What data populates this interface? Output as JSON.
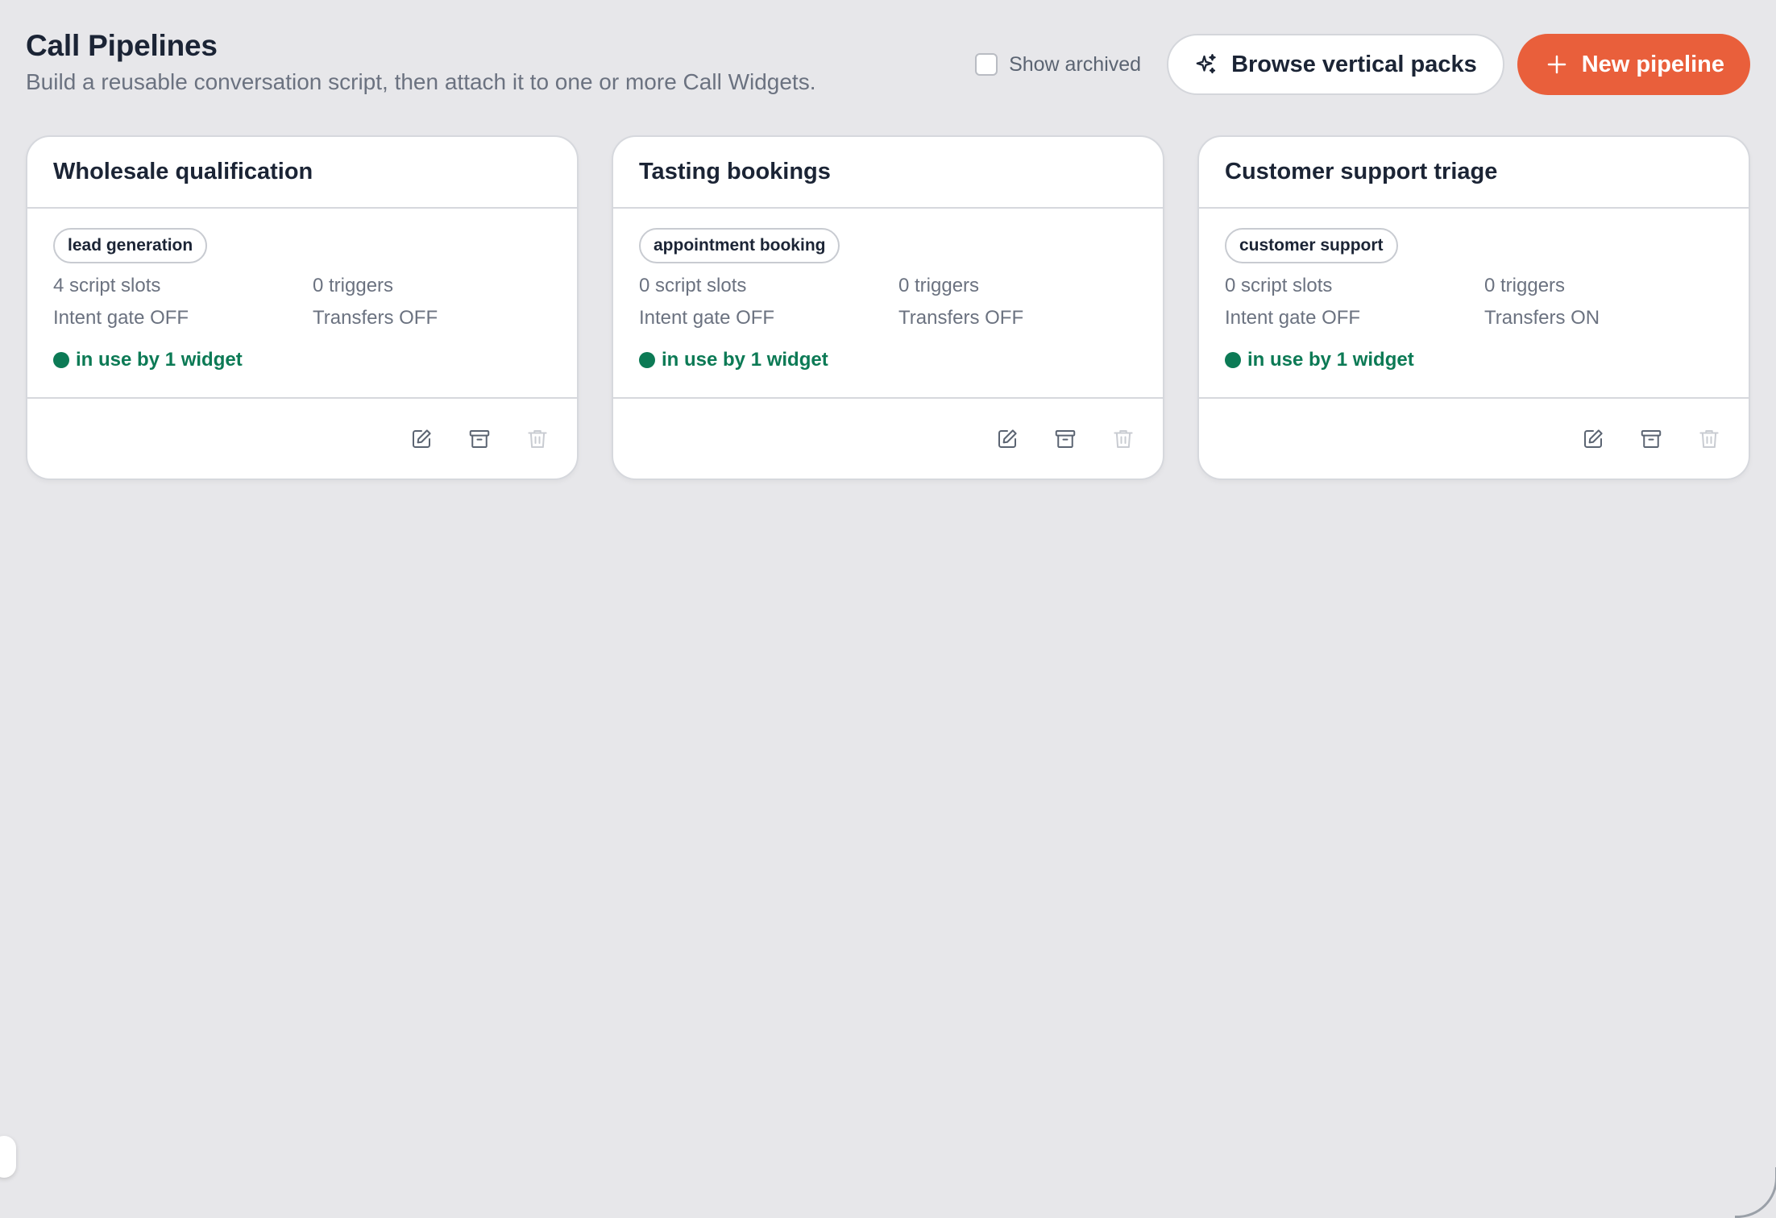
{
  "header": {
    "title": "Call Pipelines",
    "subtitle": "Build a reusable conversation script, then attach it to one or more Call Widgets."
  },
  "toolbar": {
    "show_archived_label": "Show archived",
    "show_archived_checked": false,
    "browse_label": "Browse vertical packs",
    "browse_icon": "sparkles-icon",
    "new_label": "New pipeline",
    "new_icon": "plus-icon"
  },
  "colors": {
    "background": "#e7e7ea",
    "accent": "#e95f3b",
    "status_green": "#0c7a55",
    "text": "#1b2435",
    "muted": "#6b7280"
  },
  "pipelines": [
    {
      "title": "Wholesale qualification",
      "tag": "lead generation",
      "script_slots": "4 script slots",
      "triggers": "0 triggers",
      "intent_gate": "Intent gate OFF",
      "transfers": "Transfers OFF",
      "usage": "in use by 1 widget"
    },
    {
      "title": "Tasting bookings",
      "tag": "appointment booking",
      "script_slots": "0 script slots",
      "triggers": "0 triggers",
      "intent_gate": "Intent gate OFF",
      "transfers": "Transfers OFF",
      "usage": "in use by 1 widget"
    },
    {
      "title": "Customer support triage",
      "tag": "customer support",
      "script_slots": "0 script slots",
      "triggers": "0 triggers",
      "intent_gate": "Intent gate OFF",
      "transfers": "Transfers ON",
      "usage": "in use by 1 widget"
    }
  ],
  "card_actions": [
    "edit-icon",
    "archive-icon",
    "trash-icon"
  ]
}
